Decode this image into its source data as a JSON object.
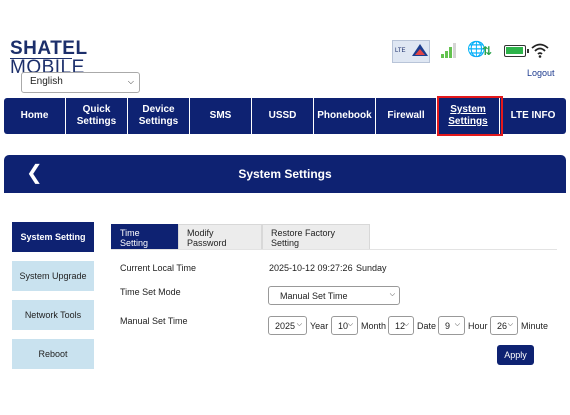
{
  "brand": {
    "line1": "SHATEL",
    "line2": "MOBILE"
  },
  "language": {
    "selected": "English"
  },
  "status": {
    "lte_label": "LTE",
    "logout": "Logout"
  },
  "nav": [
    {
      "label": "Home"
    },
    {
      "label": "Quick\nSettings"
    },
    {
      "label": "Device\nSettings"
    },
    {
      "label": "SMS"
    },
    {
      "label": "USSD"
    },
    {
      "label": "Phonebook"
    },
    {
      "label": "Firewall"
    },
    {
      "label": "System\nSettings",
      "active": true
    },
    {
      "label": "LTE INFO"
    }
  ],
  "page": {
    "title": "System Settings"
  },
  "side_menu": [
    {
      "label": "System Setting",
      "active": true
    },
    {
      "label": "System Upgrade"
    },
    {
      "label": "Network Tools"
    },
    {
      "label": "Reboot"
    }
  ],
  "tabs": [
    {
      "label": "Time Setting",
      "active": true
    },
    {
      "label": "Modify Password"
    },
    {
      "label": "Restore Factory Setting"
    }
  ],
  "form": {
    "current_time_label": "Current Local Time",
    "current_time_value": "2025-10-12 09:27:26",
    "current_day": "Sunday",
    "mode_label": "Time Set Mode",
    "mode_value": "Manual Set Time",
    "manual_label": "Manual Set Time",
    "year": "2025",
    "year_unit": "Year",
    "month": "10",
    "month_unit": "Month",
    "date": "12",
    "date_unit": "Date",
    "hour": "9",
    "hour_unit": "Hour",
    "minute": "26",
    "minute_unit": "Minute",
    "apply": "Apply"
  },
  "colors": {
    "primary": "#0e2272",
    "side_inactive": "#c9e2ef",
    "highlight": "#e3191c"
  }
}
